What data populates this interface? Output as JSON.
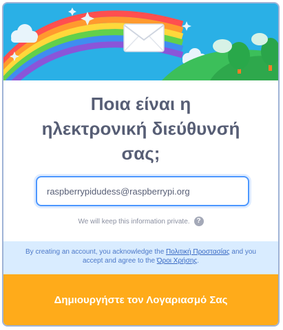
{
  "header": {
    "illustration_icon": "envelope-icon",
    "sky_color": "#2ab0e6"
  },
  "question": {
    "line1": "Ποια είναι η",
    "line2": "ηλεκτρονική διεύθυνσή",
    "line3": "σας;"
  },
  "email": {
    "value": "raspberrypidudess@raspberrypi.org"
  },
  "privacy": {
    "note": "We will keep this information private.",
    "help_icon": "question-mark-icon",
    "help_glyph": "?"
  },
  "consent": {
    "prefix": "By creating an account, you acknowledge the ",
    "privacy_link": "Πολιτική Προστασίας",
    "middle": " and you accept and agree to the ",
    "terms_link": "Όροι Χρήσης",
    "suffix": "."
  },
  "submit": {
    "label": "Δημιουργήστε τον Λογαριασμό Σας",
    "color": "#ffab1a"
  }
}
